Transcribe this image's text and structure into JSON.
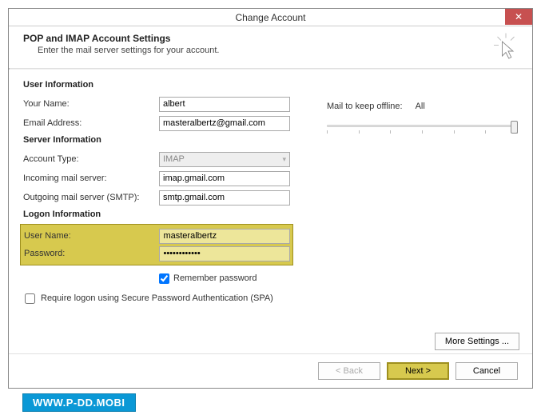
{
  "title": "Change Account",
  "header": {
    "title": "POP and IMAP Account Settings",
    "subtitle": "Enter the mail server settings for your account."
  },
  "sections": {
    "user_info": "User Information",
    "server_info": "Server Information",
    "logon_info": "Logon Information"
  },
  "labels": {
    "your_name": "Your Name:",
    "email": "Email Address:",
    "account_type": "Account Type:",
    "incoming": "Incoming mail server:",
    "outgoing": "Outgoing mail server (SMTP):",
    "username": "User Name:",
    "password": "Password:",
    "remember": "Remember password",
    "spa": "Require logon using Secure Password Authentication (SPA)",
    "mail_keep": "Mail to keep offline:",
    "mail_keep_value": "All"
  },
  "values": {
    "your_name": "albert",
    "email": "masteralbertz@gmail.com",
    "account_type": "IMAP",
    "incoming": "imap.gmail.com",
    "outgoing": "smtp.gmail.com",
    "username": "masteralbertz",
    "password": "************"
  },
  "buttons": {
    "more_settings": "More Settings ...",
    "back": "< Back",
    "next": "Next >",
    "cancel": "Cancel"
  },
  "watermark": "WWW.P-DD.MOBI"
}
